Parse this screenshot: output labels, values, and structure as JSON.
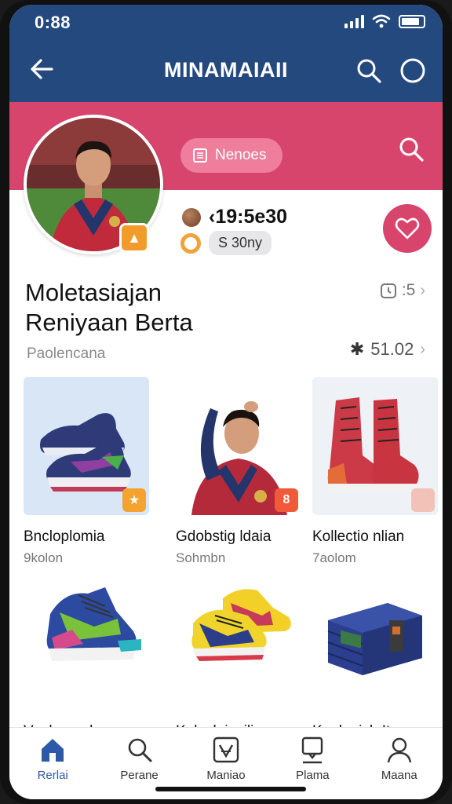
{
  "status_bar": {
    "time": "0:88",
    "battery_icon": "battery-icon",
    "wifi_icon": "wifi-icon",
    "signal_icon": "signal-icon"
  },
  "app_bar": {
    "title": "MINAMAIAII",
    "back_icon": "arrow-left-icon",
    "search_icon": "search-icon",
    "profile_icon": "circle-icon"
  },
  "banner": {
    "chip_label": "Nenoes",
    "chip_icon": "list-icon",
    "search_icon": "search-icon"
  },
  "profile": {
    "balance": "‹19:5e30",
    "points": "S 30ny",
    "badge_icon": "trophy-icon",
    "like_icon": "heart-icon"
  },
  "section": {
    "title_line1": "Moletasiajan",
    "title_line2": "Reniyaan Berta",
    "subtitle": "Paolencana",
    "meta_count": ":5",
    "meta_price": "51.02"
  },
  "products": [
    {
      "title": "Bncloplomia",
      "sub": "9kolon",
      "badge": "★"
    },
    {
      "title": "Gdobstig ldaia",
      "sub": "Sohmbn",
      "badge": "8"
    },
    {
      "title": "Kollectio nlian",
      "sub": "7aolom",
      "badge": ""
    },
    {
      "title": "Vaplamaalan",
      "sub": "",
      "badge": ""
    },
    {
      "title": "Kolecloivailis",
      "sub": "",
      "badge": ""
    },
    {
      "title": "Koolegish Item",
      "sub": "",
      "badge": ""
    }
  ],
  "nav": [
    {
      "label": "Rerlai",
      "icon": "home-icon",
      "active": true
    },
    {
      "label": "Perane",
      "icon": "search-icon",
      "active": false
    },
    {
      "label": "Maniao",
      "icon": "edit-box-icon",
      "active": false
    },
    {
      "label": "Plama",
      "icon": "chat-person-icon",
      "active": false
    },
    {
      "label": "Maana",
      "icon": "user-icon",
      "active": false
    }
  ],
  "colors": {
    "navy": "#24497e",
    "pink": "#d8456c",
    "accent_blue": "#2c5aa8"
  }
}
